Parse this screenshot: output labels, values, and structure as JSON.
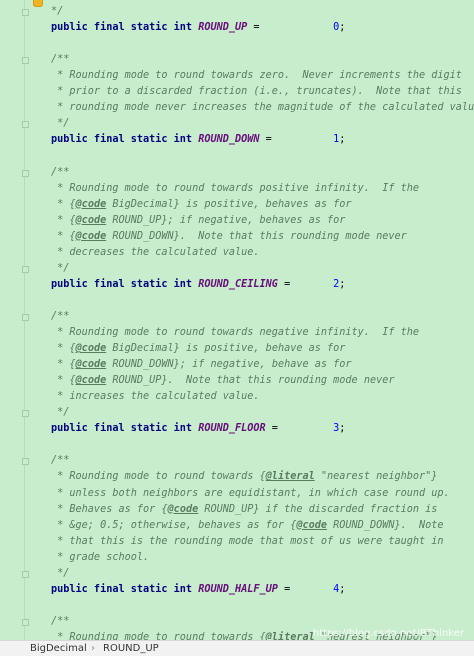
{
  "editor": {
    "lines": [
      {
        "kind": "comment",
        "text": "*/"
      },
      {
        "kind": "code",
        "parts": [
          {
            "t": "public final static int ",
            "c": "kw"
          },
          {
            "t": "ROUND_UP",
            "c": "field"
          },
          {
            "t": " =            ",
            "c": ""
          },
          {
            "t": "0",
            "c": "num"
          },
          {
            "t": ";",
            "c": ""
          }
        ]
      },
      {
        "kind": "blank"
      },
      {
        "kind": "comment",
        "text": "/**"
      },
      {
        "kind": "comment",
        "text": " * Rounding mode to round towards zero.  Never increments the digit"
      },
      {
        "kind": "comment",
        "text": " * prior to a discarded fraction (i.e., truncates).  Note that this"
      },
      {
        "kind": "comment",
        "text": " * rounding mode never increases the magnitude of the calculated value."
      },
      {
        "kind": "comment",
        "text": " */"
      },
      {
        "kind": "code",
        "parts": [
          {
            "t": "public final static int ",
            "c": "kw"
          },
          {
            "t": "ROUND_DOWN",
            "c": "field"
          },
          {
            "t": " =          ",
            "c": ""
          },
          {
            "t": "1",
            "c": "num"
          },
          {
            "t": ";",
            "c": ""
          }
        ]
      },
      {
        "kind": "blank"
      },
      {
        "kind": "comment",
        "text": "/**"
      },
      {
        "kind": "comment",
        "text": " * Rounding mode to round towards positive infinity.  If the"
      },
      {
        "kind": "comment",
        "parts": [
          {
            "t": " * {",
            "c": ""
          },
          {
            "t": "@code",
            "c": "tag"
          },
          {
            "t": " BigDecimal} is positive, behaves as for",
            "c": ""
          }
        ]
      },
      {
        "kind": "comment",
        "parts": [
          {
            "t": " * {",
            "c": ""
          },
          {
            "t": "@code",
            "c": "tag"
          },
          {
            "t": " ROUND_UP}; if negative, behaves as for",
            "c": ""
          }
        ]
      },
      {
        "kind": "comment",
        "parts": [
          {
            "t": " * {",
            "c": ""
          },
          {
            "t": "@code",
            "c": "tag"
          },
          {
            "t": " ROUND_DOWN}.  Note that this rounding mode never",
            "c": ""
          }
        ]
      },
      {
        "kind": "comment",
        "text": " * decreases the calculated value."
      },
      {
        "kind": "comment",
        "text": " */"
      },
      {
        "kind": "code",
        "parts": [
          {
            "t": "public final static int ",
            "c": "kw"
          },
          {
            "t": "ROUND_CEILING",
            "c": "field"
          },
          {
            "t": " =       ",
            "c": ""
          },
          {
            "t": "2",
            "c": "num"
          },
          {
            "t": ";",
            "c": ""
          }
        ]
      },
      {
        "kind": "blank"
      },
      {
        "kind": "comment",
        "text": "/**"
      },
      {
        "kind": "comment",
        "text": " * Rounding mode to round towards negative infinity.  If the"
      },
      {
        "kind": "comment",
        "parts": [
          {
            "t": " * {",
            "c": ""
          },
          {
            "t": "@code",
            "c": "tag"
          },
          {
            "t": " BigDecimal} is positive, behave as for",
            "c": ""
          }
        ]
      },
      {
        "kind": "comment",
        "parts": [
          {
            "t": " * {",
            "c": ""
          },
          {
            "t": "@code",
            "c": "tag"
          },
          {
            "t": " ROUND_DOWN}; if negative, behave as for",
            "c": ""
          }
        ]
      },
      {
        "kind": "comment",
        "parts": [
          {
            "t": " * {",
            "c": ""
          },
          {
            "t": "@code",
            "c": "tag"
          },
          {
            "t": " ROUND_UP}.  Note that this rounding mode never",
            "c": ""
          }
        ]
      },
      {
        "kind": "comment",
        "text": " * increases the calculated value."
      },
      {
        "kind": "comment",
        "text": " */"
      },
      {
        "kind": "code",
        "parts": [
          {
            "t": "public final static int ",
            "c": "kw"
          },
          {
            "t": "ROUND_FLOOR",
            "c": "field"
          },
          {
            "t": " =         ",
            "c": ""
          },
          {
            "t": "3",
            "c": "num"
          },
          {
            "t": ";",
            "c": ""
          }
        ]
      },
      {
        "kind": "blank"
      },
      {
        "kind": "comment",
        "text": "/**"
      },
      {
        "kind": "comment",
        "parts": [
          {
            "t": " * Rounding mode to round towards {",
            "c": ""
          },
          {
            "t": "@literal",
            "c": "tag"
          },
          {
            "t": " \"nearest neighbor\"}",
            "c": ""
          }
        ]
      },
      {
        "kind": "comment",
        "text": " * unless both neighbors are equidistant, in which case round up."
      },
      {
        "kind": "comment",
        "parts": [
          {
            "t": " * Behaves as for {",
            "c": ""
          },
          {
            "t": "@code",
            "c": "tag"
          },
          {
            "t": " ROUND_UP} if the discarded fraction is",
            "c": ""
          }
        ]
      },
      {
        "kind": "comment",
        "parts": [
          {
            "t": " * &ge; 0.5; otherwise, behaves as for {",
            "c": ""
          },
          {
            "t": "@code",
            "c": "tag"
          },
          {
            "t": " ROUND_DOWN}.  Note",
            "c": ""
          }
        ]
      },
      {
        "kind": "comment",
        "text": " * that this is the rounding mode that most of us were taught in"
      },
      {
        "kind": "comment",
        "text": " * grade school."
      },
      {
        "kind": "comment",
        "text": " */"
      },
      {
        "kind": "code",
        "parts": [
          {
            "t": "public final static int ",
            "c": "kw"
          },
          {
            "t": "ROUND_HALF_UP",
            "c": "field"
          },
          {
            "t": " =       ",
            "c": ""
          },
          {
            "t": "4",
            "c": "num"
          },
          {
            "t": ";",
            "c": ""
          }
        ]
      },
      {
        "kind": "blank"
      },
      {
        "kind": "comment",
        "text": "/**"
      },
      {
        "kind": "comment",
        "parts": [
          {
            "t": " * Rounding mode to round towards {",
            "c": ""
          },
          {
            "t": "@literal",
            "c": "tag"
          },
          {
            "t": " \"nearest neighbor\"}",
            "c": ""
          }
        ]
      }
    ]
  },
  "breadcrumb": {
    "class_name": "BigDecimal",
    "separator": "›",
    "member_name": "ROUND_UP"
  },
  "watermark": "https://blog.csdn.net/BThinker",
  "colors": {
    "background": "#c7edcc",
    "keyword": "#000080",
    "field": "#660e7a",
    "number": "#0000ff",
    "comment": "#5c7a61"
  },
  "icons": {
    "hint": "lightbulb-icon",
    "fold": "fold-marker-icon"
  }
}
